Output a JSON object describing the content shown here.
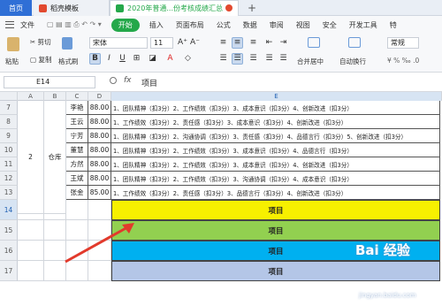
{
  "tabs": {
    "home": "首页",
    "template": "稻壳模板",
    "file": "2020年普通...份考核成绩汇总"
  },
  "menu": {
    "file": "文件",
    "items": [
      "开始",
      "插入",
      "页面布局",
      "公式",
      "数据",
      "审阅",
      "视图",
      "安全",
      "开发工具",
      "特"
    ]
  },
  "toolbar": {
    "cut": "剪切",
    "paste": "粘贴",
    "copy": "复制",
    "format_painter": "格式刷",
    "font_name": "宋体",
    "font_size": "11",
    "merge_center": "合并居中",
    "wrap": "自动换行",
    "currency": "常规"
  },
  "formula_bar": {
    "name_box": "E14",
    "fx": "fx",
    "value": "项目"
  },
  "columns": [
    "A",
    "B",
    "C",
    "D",
    "E"
  ],
  "rows": [
    {
      "num": "7",
      "name": "李艳",
      "score": "88.00",
      "text": "1、团队精神（扣3分）2、工作绩效（扣3分）3、成本意识（扣3分）4、创新改进（扣3分）"
    },
    {
      "num": "8",
      "name": "王云",
      "score": "88.00",
      "text": "1、工作绩效（扣3分）2、责任感（扣3分）3、成本意识（扣3分）4、创新改进（扣3分）"
    },
    {
      "num": "9",
      "name": "宁芳",
      "score": "88.00",
      "text": "1、团队精神（扣3分）2、沟通协调（扣3分）3、责任感（扣3分）4、品德言行（扣3分）5、创新改进（扣3分）"
    },
    {
      "num": "10",
      "name": "董慧",
      "score": "88.00",
      "text": "1、团队精神（扣3分）2、工作绩效（扣3分）3、成本意识（扣3分）4、品德言行（扣3分）"
    },
    {
      "num": "11",
      "name": "方然",
      "score": "88.00",
      "text": "1、团队精神（扣3分）2、工作绩效（扣3分）3、成本意识（扣3分）4、创新改进（扣3分）"
    },
    {
      "num": "12",
      "name": "王斌",
      "score": "88.00",
      "text": "1、团队精神（扣3分）2、工作绩效（扣3分）3、沟通协调（扣3分）4、成本意识（扣3分）"
    },
    {
      "num": "13",
      "name": "张金",
      "score": "85.00",
      "text": "1、工作绩效（扣3分）2、责任感（扣3分）3、品德言行（扣3分）4、创新改进（扣3分）"
    }
  ],
  "group": {
    "number": "2",
    "dept": "仓库"
  },
  "bands": [
    {
      "num": "14",
      "label": "项目",
      "color": "#f7f000"
    },
    {
      "num": "15",
      "label": "项目",
      "color": "#92d050"
    },
    {
      "num": "16",
      "label": "项目",
      "color": "#00b0f0"
    },
    {
      "num": "17",
      "label": "项目",
      "color": "#b4c6e7"
    }
  ],
  "watermark": {
    "brand": "Bai 经验",
    "url": "jingyan.baidu.com"
  },
  "colors": {
    "accent": "#2f6fd6",
    "start": "#24a84a",
    "arrow": "#e23a2c"
  }
}
